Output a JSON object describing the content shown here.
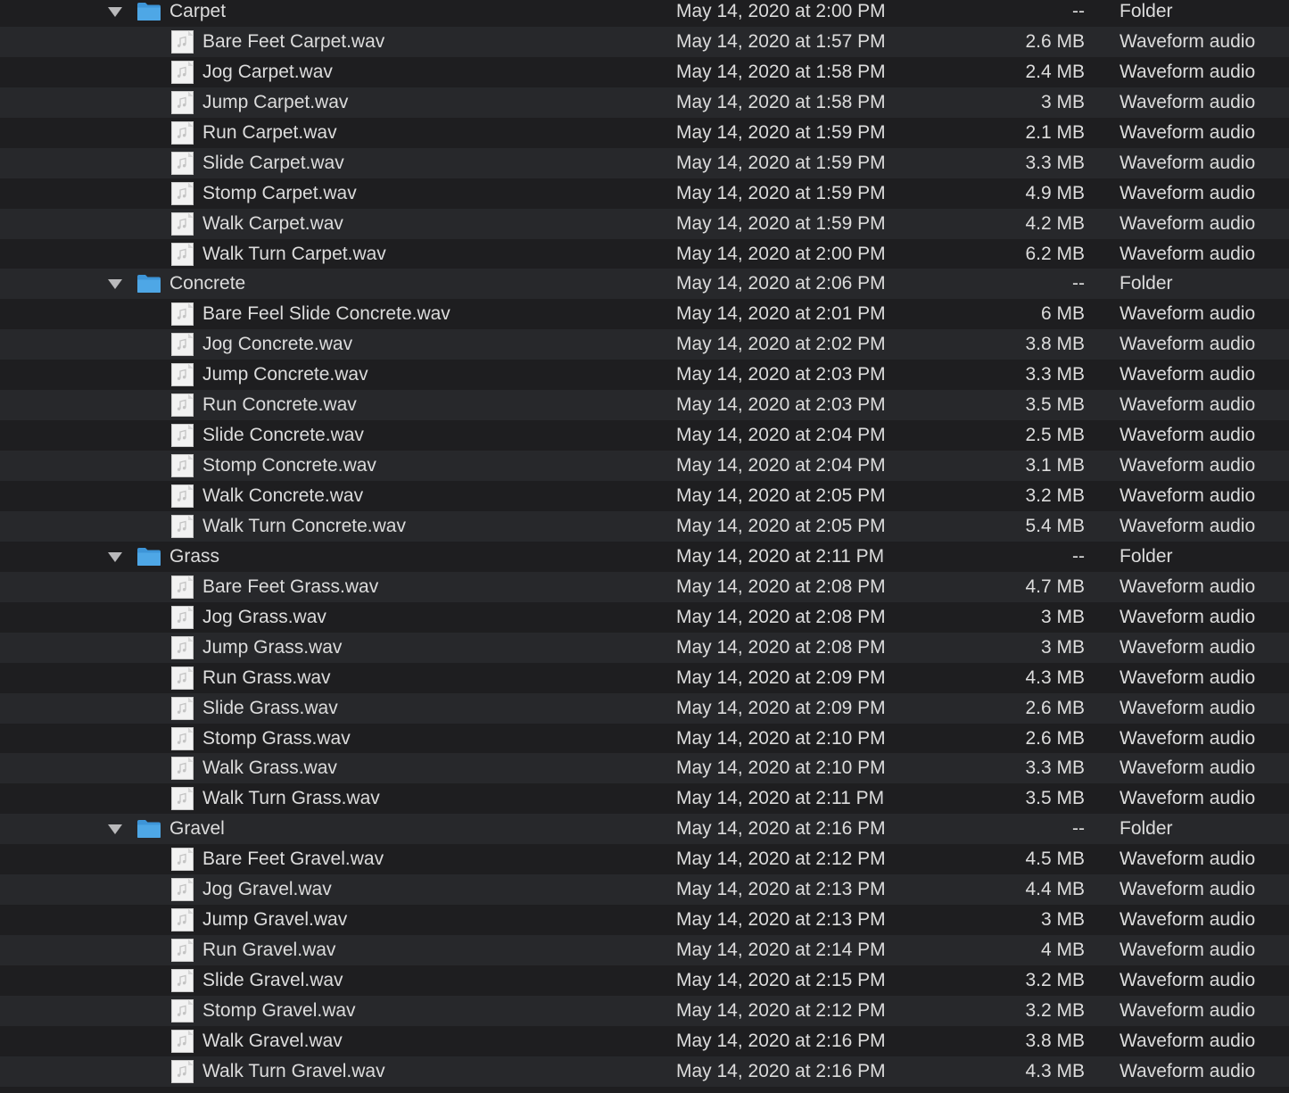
{
  "colors": {
    "background": "#1e1e20",
    "stripe": "#27282b",
    "text": "#dcdcdc",
    "folder": "#4ea7e6"
  },
  "icons": {
    "folder": "folder-icon",
    "file": "audio-file-icon",
    "disclosure": "disclosure-triangle-expanded-icon"
  },
  "folders": [
    {
      "name": "Carpet",
      "date": "May 14, 2020 at 2:00 PM",
      "size": "--",
      "kind": "Folder",
      "files": [
        {
          "name": "Bare Feet Carpet.wav",
          "date": "May 14, 2020 at 1:57 PM",
          "size": "2.6 MB",
          "kind": "Waveform audio"
        },
        {
          "name": "Jog Carpet.wav",
          "date": "May 14, 2020 at 1:58 PM",
          "size": "2.4 MB",
          "kind": "Waveform audio"
        },
        {
          "name": "Jump Carpet.wav",
          "date": "May 14, 2020 at 1:58 PM",
          "size": "3 MB",
          "kind": "Waveform audio"
        },
        {
          "name": "Run Carpet.wav",
          "date": "May 14, 2020 at 1:59 PM",
          "size": "2.1 MB",
          "kind": "Waveform audio"
        },
        {
          "name": "Slide Carpet.wav",
          "date": "May 14, 2020 at 1:59 PM",
          "size": "3.3 MB",
          "kind": "Waveform audio"
        },
        {
          "name": "Stomp Carpet.wav",
          "date": "May 14, 2020 at 1:59 PM",
          "size": "4.9 MB",
          "kind": "Waveform audio"
        },
        {
          "name": "Walk Carpet.wav",
          "date": "May 14, 2020 at 1:59 PM",
          "size": "4.2 MB",
          "kind": "Waveform audio"
        },
        {
          "name": "Walk Turn Carpet.wav",
          "date": "May 14, 2020 at 2:00 PM",
          "size": "6.2 MB",
          "kind": "Waveform audio"
        }
      ]
    },
    {
      "name": "Concrete",
      "date": "May 14, 2020 at 2:06 PM",
      "size": "--",
      "kind": "Folder",
      "files": [
        {
          "name": "Bare Feel Slide Concrete.wav",
          "date": "May 14, 2020 at 2:01 PM",
          "size": "6 MB",
          "kind": "Waveform audio"
        },
        {
          "name": "Jog Concrete.wav",
          "date": "May 14, 2020 at 2:02 PM",
          "size": "3.8 MB",
          "kind": "Waveform audio"
        },
        {
          "name": "Jump Concrete.wav",
          "date": "May 14, 2020 at 2:03 PM",
          "size": "3.3 MB",
          "kind": "Waveform audio"
        },
        {
          "name": "Run Concrete.wav",
          "date": "May 14, 2020 at 2:03 PM",
          "size": "3.5 MB",
          "kind": "Waveform audio"
        },
        {
          "name": "Slide Concrete.wav",
          "date": "May 14, 2020 at 2:04 PM",
          "size": "2.5 MB",
          "kind": "Waveform audio"
        },
        {
          "name": "Stomp Concrete.wav",
          "date": "May 14, 2020 at 2:04 PM",
          "size": "3.1 MB",
          "kind": "Waveform audio"
        },
        {
          "name": "Walk Concrete.wav",
          "date": "May 14, 2020 at 2:05 PM",
          "size": "3.2 MB",
          "kind": "Waveform audio"
        },
        {
          "name": "Walk Turn Concrete.wav",
          "date": "May 14, 2020 at 2:05 PM",
          "size": "5.4 MB",
          "kind": "Waveform audio"
        }
      ]
    },
    {
      "name": "Grass",
      "date": "May 14, 2020 at 2:11 PM",
      "size": "--",
      "kind": "Folder",
      "files": [
        {
          "name": "Bare Feet Grass.wav",
          "date": "May 14, 2020 at 2:08 PM",
          "size": "4.7 MB",
          "kind": "Waveform audio"
        },
        {
          "name": "Jog Grass.wav",
          "date": "May 14, 2020 at 2:08 PM",
          "size": "3 MB",
          "kind": "Waveform audio"
        },
        {
          "name": "Jump Grass.wav",
          "date": "May 14, 2020 at 2:08 PM",
          "size": "3 MB",
          "kind": "Waveform audio"
        },
        {
          "name": "Run Grass.wav",
          "date": "May 14, 2020 at 2:09 PM",
          "size": "4.3 MB",
          "kind": "Waveform audio"
        },
        {
          "name": "Slide Grass.wav",
          "date": "May 14, 2020 at 2:09 PM",
          "size": "2.6 MB",
          "kind": "Waveform audio"
        },
        {
          "name": "Stomp Grass.wav",
          "date": "May 14, 2020 at 2:10 PM",
          "size": "2.6 MB",
          "kind": "Waveform audio"
        },
        {
          "name": "Walk Grass.wav",
          "date": "May 14, 2020 at 2:10 PM",
          "size": "3.3 MB",
          "kind": "Waveform audio"
        },
        {
          "name": "Walk Turn Grass.wav",
          "date": "May 14, 2020 at 2:11 PM",
          "size": "3.5 MB",
          "kind": "Waveform audio"
        }
      ]
    },
    {
      "name": "Gravel",
      "date": "May 14, 2020 at 2:16 PM",
      "size": "--",
      "kind": "Folder",
      "files": [
        {
          "name": "Bare Feet Gravel.wav",
          "date": "May 14, 2020 at 2:12 PM",
          "size": "4.5 MB",
          "kind": "Waveform audio"
        },
        {
          "name": "Jog Gravel.wav",
          "date": "May 14, 2020 at 2:13 PM",
          "size": "4.4 MB",
          "kind": "Waveform audio"
        },
        {
          "name": "Jump Gravel.wav",
          "date": "May 14, 2020 at 2:13 PM",
          "size": "3 MB",
          "kind": "Waveform audio"
        },
        {
          "name": "Run Gravel.wav",
          "date": "May 14, 2020 at 2:14 PM",
          "size": "4 MB",
          "kind": "Waveform audio"
        },
        {
          "name": "Slide Gravel.wav",
          "date": "May 14, 2020 at 2:15 PM",
          "size": "3.2 MB",
          "kind": "Waveform audio"
        },
        {
          "name": "Stomp Gravel.wav",
          "date": "May 14, 2020 at 2:12 PM",
          "size": "3.2 MB",
          "kind": "Waveform audio"
        },
        {
          "name": "Walk Gravel.wav",
          "date": "May 14, 2020 at 2:16 PM",
          "size": "3.8 MB",
          "kind": "Waveform audio"
        },
        {
          "name": "Walk Turn Gravel.wav",
          "date": "May 14, 2020 at 2:16 PM",
          "size": "4.3 MB",
          "kind": "Waveform audio"
        }
      ]
    }
  ]
}
